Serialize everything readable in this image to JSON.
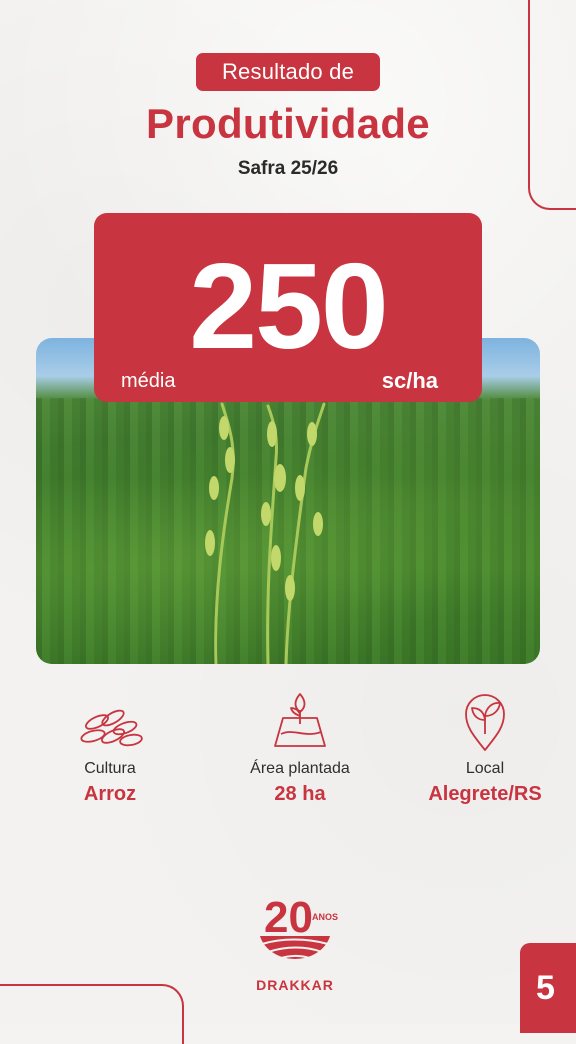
{
  "header": {
    "pill_label": "Resultado de",
    "title": "Produtividade",
    "subtitle": "Safra 25/26"
  },
  "result": {
    "value": "250",
    "caption": "média",
    "unit": "sc/ha"
  },
  "info": [
    {
      "icon": "rice-grains-icon",
      "label": "Cultura",
      "value": "Arroz"
    },
    {
      "icon": "planted-area-icon",
      "label": "Área plantada",
      "value": "28 ha"
    },
    {
      "icon": "location-leaf-icon",
      "label": "Local",
      "value": "Alegrete/RS"
    }
  ],
  "brand": {
    "years": "20",
    "years_word": "ANOS",
    "name": "DRAKKAR"
  },
  "page_number": "5",
  "colors": {
    "accent": "#c8343f",
    "background": "#f3f2f0",
    "text_dark": "#2a2a2a"
  }
}
